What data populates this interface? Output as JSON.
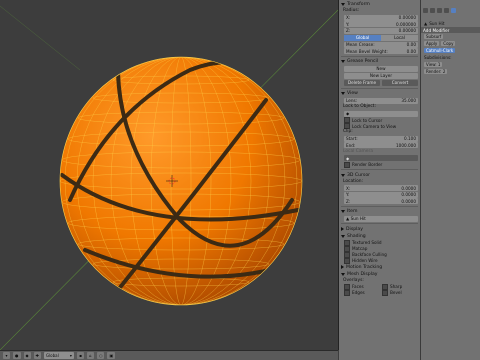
{
  "transform_panel": {
    "title": "Transform",
    "radius_label": "Radius:",
    "radius": [
      {
        "axis": "X:",
        "value": "0.00000"
      },
      {
        "axis": "Y:",
        "value": "0.000000"
      },
      {
        "axis": "Z:",
        "value": "0.00000"
      }
    ],
    "tab_global": "Global",
    "tab_local": "Local",
    "mean_crease_label": "Mean Crease:",
    "mean_crease_value": "0.00",
    "mean_bevel_label": "Mean Bevel Weight:",
    "mean_bevel_value": "0.00"
  },
  "grease_pencil": {
    "title": "Grease Pencil",
    "new_label": "New",
    "new_layer_label": "New Layer",
    "delete_frame": "Delete Frame",
    "convert": "Convert"
  },
  "view_panel": {
    "title": "View",
    "lens_label": "Lens:",
    "lens_value": "35.000",
    "lock_to_object": "Lock to Object:",
    "lock_to_cursor": "Lock to Cursor",
    "lock_camera": "Lock Camera to View",
    "clip_label": "Clip:",
    "clip_start_label": "Start:",
    "clip_start_value": "0.100",
    "clip_end_label": "End:",
    "clip_end_value": "1000.000",
    "local_camera": "Local Camera",
    "render_border": "Render Border"
  },
  "cursor_panel": {
    "title": "3D Cursor",
    "location_label": "Location:",
    "location": [
      {
        "axis": "X:",
        "value": "0.0000"
      },
      {
        "axis": "Y:",
        "value": "0.0000"
      },
      {
        "axis": "Z:",
        "value": "0.0000"
      }
    ]
  },
  "item_panel": {
    "title": "Item",
    "name": "Sun Hit"
  },
  "display_panel": {
    "title": "Display",
    "shading_title": "Shading",
    "textured_solid": "Textured Solid",
    "matcap": "Matcap",
    "backface_culling": "Backface Culling",
    "hidden_wire": "Hidden Wire",
    "motion_tracking": "Motion Tracking",
    "mesh_display": "Mesh Display",
    "overlays_label": "Overlays:",
    "overlays": [
      "Faces",
      "Edges",
      "Creases",
      "Seams",
      "Sharp",
      "Bevel",
      "Edge Weights"
    ]
  },
  "status_bar": {
    "mode": "Global"
  },
  "right_pane": {
    "object_name": "Sun Hit",
    "header": "Add Modifier",
    "modifier_name": "Subsurf",
    "apply_label": "Apply",
    "copy_label": "Copy",
    "mode_label": "Catmull-Clark",
    "subdivisions_label": "Subdivisions:",
    "view_label": "View:",
    "view_value": "1",
    "render_label": "Render:",
    "render_value": "2"
  },
  "colors": {
    "ball_orange": "#f07800",
    "ball_shadow": "#b04a00",
    "seam_dark": "#3c2a14",
    "wire_yellow": "#ffd24a",
    "panel_bg": "#727272",
    "viewport_bg": "#3d3d3d",
    "accent_blue": "#5680c2"
  }
}
